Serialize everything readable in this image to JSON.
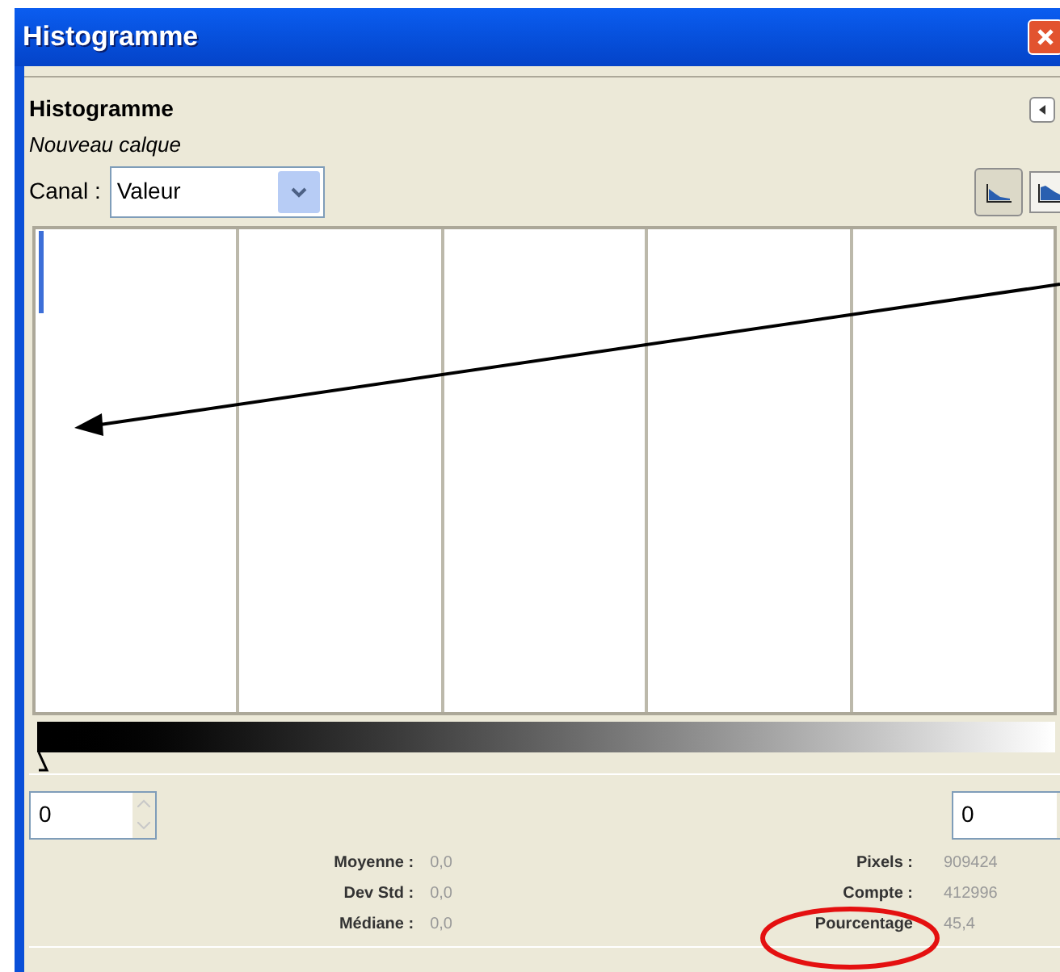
{
  "window": {
    "title": "Histogramme"
  },
  "panel": {
    "title": "Histogramme",
    "layer": "Nouveau calque"
  },
  "channel": {
    "label": "Canal :",
    "value": "Valeur"
  },
  "view_buttons": [
    {
      "kind": "linear",
      "selected": true
    },
    {
      "kind": "log",
      "selected": false
    }
  ],
  "range": {
    "start": "0",
    "end": "0"
  },
  "stats_left": [
    {
      "label": "Moyenne :",
      "value": "0,0"
    },
    {
      "label": "Dev Std :",
      "value": "0,0"
    },
    {
      "label": "Médiane :",
      "value": "0,0"
    }
  ],
  "stats_right": [
    {
      "label": "Pixels :",
      "value": "909424"
    },
    {
      "label": "Compte :",
      "value": "412996"
    },
    {
      "label": "Pourcentage",
      "value": "45,4"
    }
  ]
}
